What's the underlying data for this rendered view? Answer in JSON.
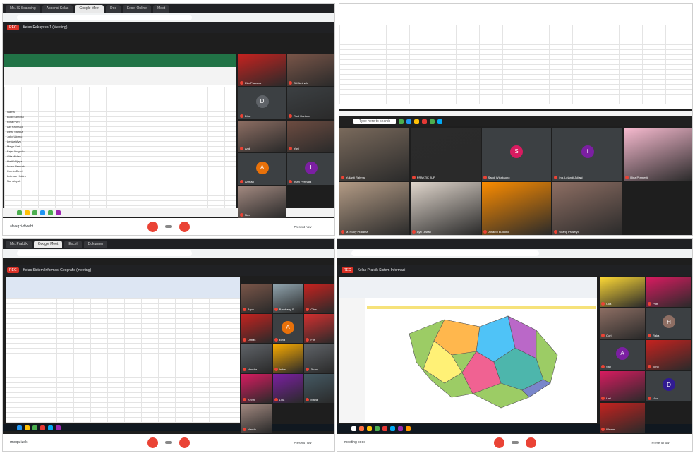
{
  "q1": {
    "tabs": [
      "Ms. IS-Scanning",
      "Absensi Kelas",
      "Google Meet",
      "Doc",
      "Excel Online",
      "Meet"
    ],
    "meeting_title": "Kelas Rekayasa 1 (Meeting)",
    "meeting_code": "abvxqzi-dlwebt",
    "present_label": "Present now",
    "rows": [
      "Nama",
      "Budi Santoso",
      "Rina Putri",
      "Alif Rahmad",
      "Dewi Sartika",
      "Joko Utomo",
      "Lestari Ayu",
      "Mega Sari",
      "Fajar Nugroho",
      "Gita Wulan",
      "Hadi Wijaya",
      "Indah Permata",
      "Kurnia Dewi",
      "Lukman Hakim",
      "Nur Aisyah"
    ],
    "participants": [
      {
        "name": "Eko Pratama",
        "letter": "",
        "color": "#c5221f"
      },
      {
        "name": "Siti Aminah",
        "letter": "",
        "color": "#795548"
      },
      {
        "name": "Dina",
        "letter": "D",
        "color": "#5f6368"
      },
      {
        "name": "Rudi Hartono",
        "letter": "",
        "color": "#3c4043"
      },
      {
        "name": "Andi",
        "letter": "",
        "color": "#8d6e63"
      },
      {
        "name": "Yuni",
        "letter": "",
        "color": "#6d4c41"
      },
      {
        "name": "Ahmad",
        "letter": "A",
        "color": "#e8710a"
      },
      {
        "name": "Intan Permata",
        "letter": "I",
        "color": "#7b1fa2"
      },
      {
        "name": "Novi",
        "letter": "",
        "color": "#a1887f"
      }
    ]
  },
  "q2": {
    "search_placeholder": "Type here to search",
    "participants": [
      {
        "name": "Yulianti Rahma",
        "letter": "",
        "color": "#7a6a5c"
      },
      {
        "name": "PRAKTIK JUP",
        "letter": "",
        "color": "#2b2b2b"
      },
      {
        "name": "Sandi Wicaksono",
        "letter": "S",
        "color": "#d81b60"
      },
      {
        "name": "Ing. Lelandi Juliani",
        "letter": "i",
        "color": "#7b1fa2"
      },
      {
        "name": "Rina Pramesti",
        "letter": "",
        "color": "#f8bbd0"
      },
      {
        "name": "M. Rizky Pratama",
        "letter": "",
        "color": "#b39b85"
      },
      {
        "name": "Ayu Lestari",
        "letter": "",
        "color": "#e0d6cc"
      },
      {
        "name": "Junaedi Budiono",
        "letter": "",
        "color": "#fb8c00"
      },
      {
        "name": "Gilang Prasetyo",
        "letter": "",
        "color": "#8d6e63"
      }
    ]
  },
  "q3": {
    "tabs": [
      "Ms. Praktik",
      "Google Meet",
      "Excel",
      "Dokumen"
    ],
    "meeting_title": "Kelas Sistem Informasi Geografis (meeting)",
    "meeting_code": "rmxqa-izdk",
    "present_label": "Present now",
    "participants": [
      {
        "name": "Agus",
        "letter": "",
        "color": "#795548"
      },
      {
        "name": "Bambang S",
        "letter": "",
        "color": "#90a4ae"
      },
      {
        "name": "Citra",
        "letter": "",
        "color": "#c5221f"
      },
      {
        "name": "Dimas",
        "letter": "",
        "color": "#c5221f"
      },
      {
        "name": "Erna",
        "letter": "A",
        "color": "#e8710a"
      },
      {
        "name": "Fitri",
        "letter": "",
        "color": "#d32f2f"
      },
      {
        "name": "Hendra",
        "letter": "",
        "color": "#5f6368"
      },
      {
        "name": "Indra",
        "letter": "",
        "color": "#f9ab00"
      },
      {
        "name": "Jihan",
        "letter": "",
        "color": "#5f6368"
      },
      {
        "name": "Kevin",
        "letter": "",
        "color": "#d81b60"
      },
      {
        "name": "Lina",
        "letter": "",
        "color": "#7b1fa2"
      },
      {
        "name": "Maya",
        "letter": "",
        "color": "#455a64"
      },
      {
        "name": "Nando",
        "letter": "",
        "color": "#a1887f"
      }
    ]
  },
  "q4": {
    "meeting_title": "Kelas Praktik Sistem Informasi",
    "meeting_code": "meeting code",
    "present_label": "Present now",
    "participants": [
      {
        "name": "Oka",
        "letter": "",
        "color": "#fdd835"
      },
      {
        "name": "Putri",
        "letter": "",
        "color": "#d81b60"
      },
      {
        "name": "Qori",
        "letter": "",
        "color": "#8d6e63"
      },
      {
        "name": "Raka",
        "letter": "H",
        "color": "#8d6e63"
      },
      {
        "name": "Sari",
        "letter": "A",
        "color": "#7b1fa2"
      },
      {
        "name": "Tono",
        "letter": "",
        "color": "#c5221f"
      },
      {
        "name": "Umi",
        "letter": "",
        "color": "#d81b60"
      },
      {
        "name": "Vina",
        "letter": "D",
        "color": "#311b92"
      },
      {
        "name": "Wawan",
        "letter": "",
        "color": "#c5221f"
      }
    ]
  }
}
